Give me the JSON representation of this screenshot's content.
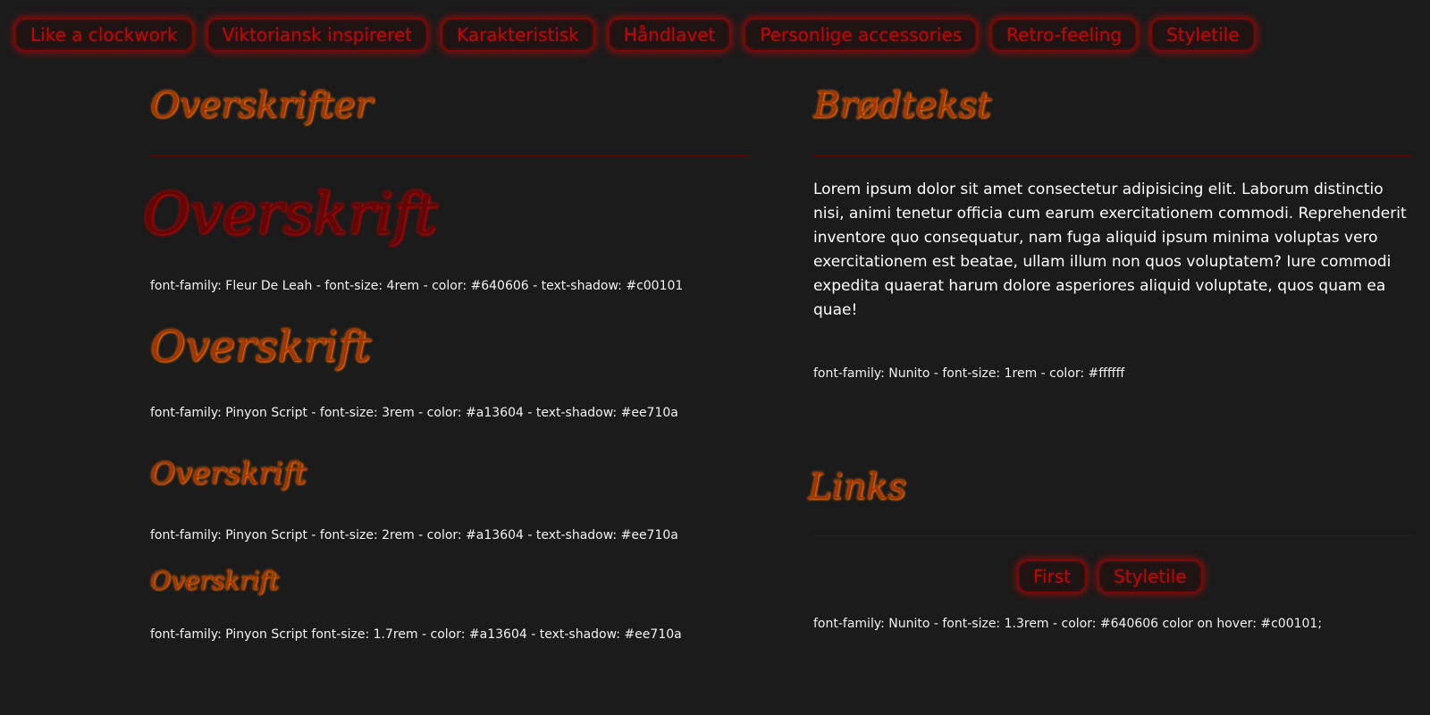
{
  "nav": {
    "items": [
      {
        "label": "Like a clockwork"
      },
      {
        "label": "Viktoriansk inspireret"
      },
      {
        "label": "Karakteristisk"
      },
      {
        "label": "Håndlavet"
      },
      {
        "label": "Personlige accessories"
      },
      {
        "label": "Retro-feeling"
      },
      {
        "label": "Styletile"
      }
    ]
  },
  "headings_section": {
    "title": "Overskrifter",
    "samples": [
      {
        "text": "Overskrift",
        "spec": "font-family: Fleur De Leah - font-size: 4rem - color: #640606 - text-shadow: #c00101"
      },
      {
        "text": "Overskrift",
        "spec": "font-family: Pinyon Script - font-size: 3rem - color: #a13604 - text-shadow: #ee710a"
      },
      {
        "text": "Overskrift",
        "spec": "font-family: Pinyon Script - font-size: 2rem - color: #a13604 - text-shadow: #ee710a"
      },
      {
        "text": "Overskrift",
        "spec": "font-family: Pinyon Script font-size: 1.7rem - color: #a13604 - text-shadow: #ee710a"
      }
    ]
  },
  "body_section": {
    "title": "Brødtekst",
    "paragraph": "Lorem ipsum dolor sit amet consectetur adipisicing elit. Laborum distinctio nisi, animi tenetur officia cum earum exercitationem commodi. Reprehenderit inventore quo consequatur, nam fuga aliquid ipsum minima voluptas vero exercitationem est beatae, ullam illum non quos voluptatem? Iure commodi expedita quaerat harum dolore asperiores aliquid voluptate, quos quam ea quae!",
    "spec": "font-family: Nunito - font-size: 1rem - color: #ffffff"
  },
  "links_section": {
    "title": "Links",
    "buttons": [
      {
        "label": "First"
      },
      {
        "label": "Styletile"
      }
    ],
    "spec": "font-family: Nunito - font-size: 1.3rem - color: #640606 color on hover: #c00101;"
  },
  "colors": {
    "background": "#1b1b1b",
    "heading_primary": "#640606",
    "heading_shadow_primary": "#c00101",
    "heading_secondary": "#a13604",
    "heading_shadow_secondary": "#ee710a",
    "body_text": "#ffffff"
  }
}
